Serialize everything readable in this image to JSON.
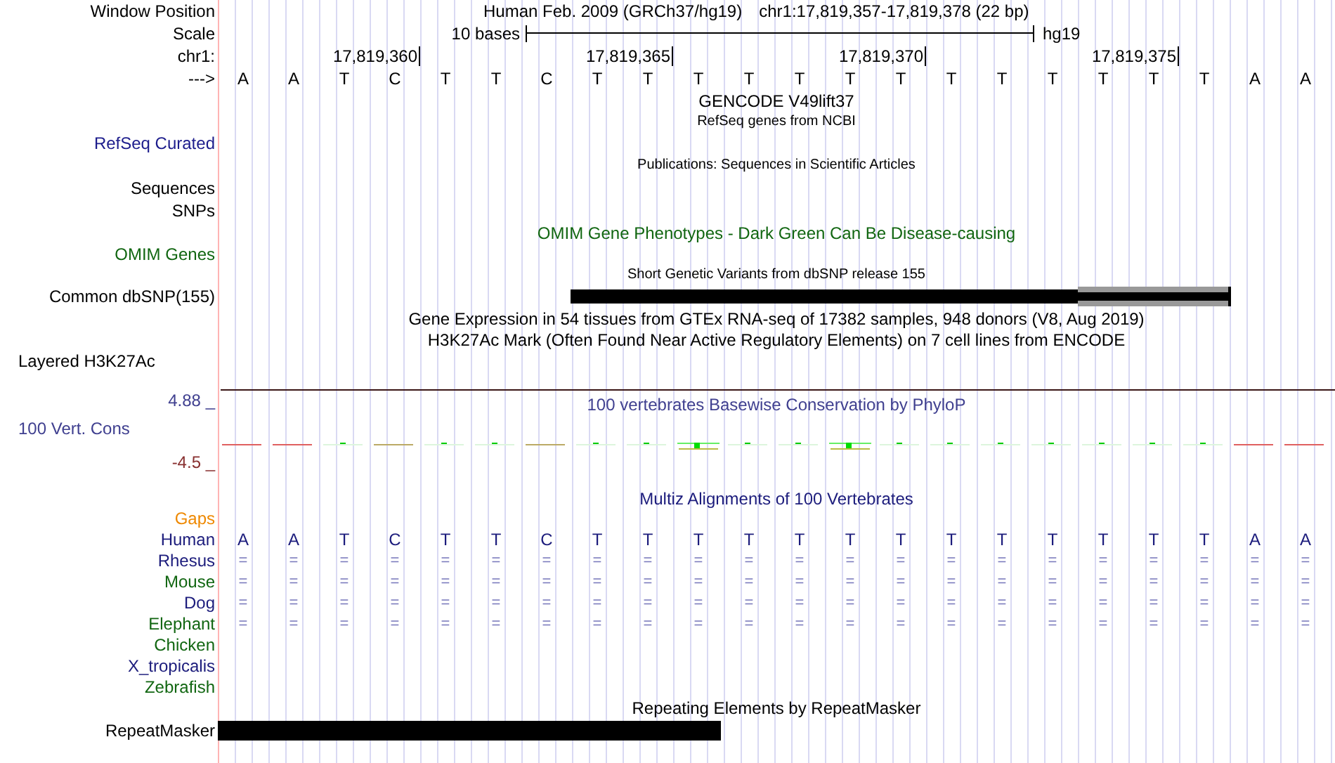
{
  "position": {
    "label": "Window Position",
    "assembly": "Human Feb. 2009 (GRCh37/hg19)",
    "range": "chr1:17,819,357-17,819,378 (22 bp)"
  },
  "scale": {
    "label": "Scale",
    "length": "10 bases",
    "db": "hg19"
  },
  "ruler": {
    "label": "chr1:",
    "ticks": [
      "17,819,360",
      "17,819,365",
      "17,819,370",
      "17,819,375"
    ]
  },
  "sequence": {
    "label": "--->",
    "bases": [
      "A",
      "A",
      "T",
      "C",
      "T",
      "T",
      "C",
      "T",
      "T",
      "T",
      "T",
      "T",
      "T",
      "T",
      "T",
      "T",
      "T",
      "T",
      "T",
      "T",
      "A",
      "A"
    ]
  },
  "tracks": [
    {
      "kind": "title",
      "text": "GENCODE V49lift37",
      "color": "#000000"
    },
    {
      "kind": "caption",
      "text": "RefSeq genes from NCBI"
    },
    {
      "kind": "label",
      "label": "RefSeq Curated",
      "color": "#1c1c8c"
    },
    {
      "kind": "caption",
      "text": "Publications: Sequences in Scientific Articles"
    },
    {
      "kind": "label",
      "label": "Sequences",
      "color": "#000000"
    },
    {
      "kind": "label",
      "label": "SNPs",
      "color": "#000000"
    },
    {
      "kind": "title",
      "text": "OMIM Gene Phenotypes - Dark Green Can Be Disease-causing",
      "color": "#116611"
    },
    {
      "kind": "label",
      "label": "OMIM Genes",
      "color": "#116611"
    },
    {
      "kind": "caption",
      "text": "Short Genetic Variants from dbSNP release 155"
    },
    {
      "kind": "snp",
      "label": "Common dbSNP(155)",
      "color": "#000000"
    },
    {
      "kind": "title",
      "text": "Gene Expression in 54 tissues from GTEx RNA-seq of 17382 samples, 948 donors (V8, Aug 2019)",
      "color": "#000000"
    },
    {
      "kind": "title",
      "text": "H3K27Ac Mark (Often Found Near Active Regulatory Elements) on 7 cell lines from ENCODE",
      "color": "#000000"
    },
    {
      "kind": "group",
      "label": "Layered H3K27Ac",
      "color": "#000000"
    }
  ],
  "conservation": {
    "title": "100 vertebrates Basewise Conservation by PhyloP",
    "label": "100 Vert. Cons",
    "max": "4.88 _",
    "min": "-4.5 _"
  },
  "multiz": {
    "title": "Multiz Alignments of 100 Vertebrates",
    "gaps": "Gaps",
    "species": [
      {
        "name": "Human",
        "color": "#1c1c7c",
        "kind": "bases",
        "cells": [
          "A",
          "A",
          "T",
          "C",
          "T",
          "T",
          "C",
          "T",
          "T",
          "T",
          "T",
          "T",
          "T",
          "T",
          "T",
          "T",
          "T",
          "T",
          "T",
          "T",
          "A",
          "A"
        ]
      },
      {
        "name": "Rhesus",
        "color": "#1c1c7c",
        "kind": "match",
        "cells": [
          "=",
          "=",
          "=",
          "=",
          "=",
          "=",
          "=",
          "=",
          "=",
          "=",
          "=",
          "=",
          "=",
          "=",
          "=",
          "=",
          "=",
          "=",
          "=",
          "=",
          "=",
          "="
        ]
      },
      {
        "name": "Mouse",
        "color": "#116611",
        "kind": "match",
        "cells": [
          "=",
          "=",
          "=",
          "=",
          "=",
          "=",
          "=",
          "=",
          "=",
          "=",
          "=",
          "=",
          "=",
          "=",
          "=",
          "=",
          "=",
          "=",
          "=",
          "=",
          "=",
          "="
        ]
      },
      {
        "name": "Dog",
        "color": "#1c1c7c",
        "kind": "match",
        "cells": [
          "=",
          "=",
          "=",
          "=",
          "=",
          "=",
          "=",
          "=",
          "=",
          "=",
          "=",
          "=",
          "=",
          "=",
          "=",
          "=",
          "=",
          "=",
          "=",
          "=",
          "=",
          "="
        ]
      },
      {
        "name": "Elephant",
        "color": "#116611",
        "kind": "match",
        "cells": [
          "=",
          "=",
          "=",
          "=",
          "=",
          "=",
          "=",
          "=",
          "=",
          "=",
          "=",
          "=",
          "=",
          "=",
          "=",
          "=",
          "=",
          "=",
          "=",
          "=",
          "=",
          "="
        ]
      },
      {
        "name": "Chicken",
        "color": "#116611",
        "kind": "none"
      },
      {
        "name": "X_tropicalis",
        "color": "#1c1c7c",
        "kind": "none"
      },
      {
        "name": "Zebrafish",
        "color": "#116611",
        "kind": "none"
      }
    ]
  },
  "repeats": {
    "title": "Repeating Elements by RepeatMasker",
    "label": "RepeatMasker"
  }
}
